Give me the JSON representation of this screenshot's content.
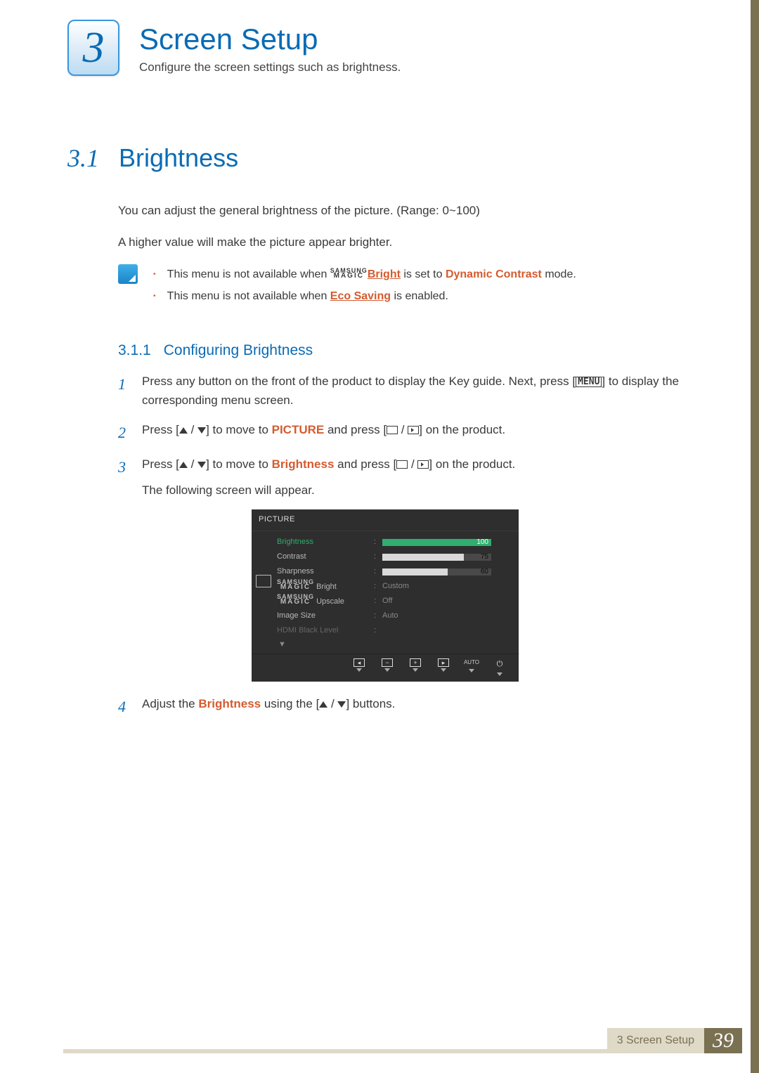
{
  "chapter": {
    "number": "3",
    "title": "Screen Setup",
    "subtitle": "Configure the screen settings such as brightness."
  },
  "section": {
    "number": "3.1",
    "title": "Brightness"
  },
  "intro": {
    "p1": "You can adjust the general brightness of the picture. (Range: 0~100)",
    "p2": "A higher value will make the picture appear brighter."
  },
  "magic": {
    "l1": "SAMSUNG",
    "l2": "MAGIC"
  },
  "notes": {
    "n1_a": "This menu is not available when ",
    "n1_b": "Bright",
    "n1_c": " is set to ",
    "n1_d": "Dynamic Contrast",
    "n1_e": " mode.",
    "n2_a": "This menu is not available when ",
    "n2_b": "Eco Saving",
    "n2_c": " is enabled."
  },
  "subsection": {
    "number": "3.1.1",
    "title": "Configuring Brightness"
  },
  "steps": {
    "menu_key": "MENU",
    "s1": "Press any button on the front of the product to display the Key guide. Next, press [",
    "s1b": "] to display the corresponding menu screen.",
    "s2a": "Press [",
    "s2b": "] to move to ",
    "s2_picture": "PICTURE",
    "s2c": " and press [",
    "s2d": "] on the product.",
    "s3b": "] to move to ",
    "s3_bright": "Brightness",
    "s3c": " and press [",
    "s3d": "] on the product.",
    "s3_follow": "The following screen will appear.",
    "s4a": "Adjust the ",
    "s4_bright": "Brightness",
    "s4b": " using the [",
    "s4c": "] buttons."
  },
  "osd": {
    "title": "PICTURE",
    "rows": [
      {
        "label": "Brightness",
        "bar": 100,
        "num": "100",
        "hi": true
      },
      {
        "label": "Contrast",
        "bar": 75,
        "num": "75"
      },
      {
        "label": "Sharpness",
        "bar": 60,
        "num": "60"
      },
      {
        "label_magic": "Bright",
        "value": "Custom"
      },
      {
        "label_magic": "Upscale",
        "value": "Off"
      },
      {
        "label": "Image Size",
        "value": "Auto"
      },
      {
        "label": "HDMI Black Level",
        "dim": true,
        "value": ""
      }
    ],
    "auto": "AUTO"
  },
  "footer": {
    "text": "3 Screen Setup",
    "page": "39"
  }
}
